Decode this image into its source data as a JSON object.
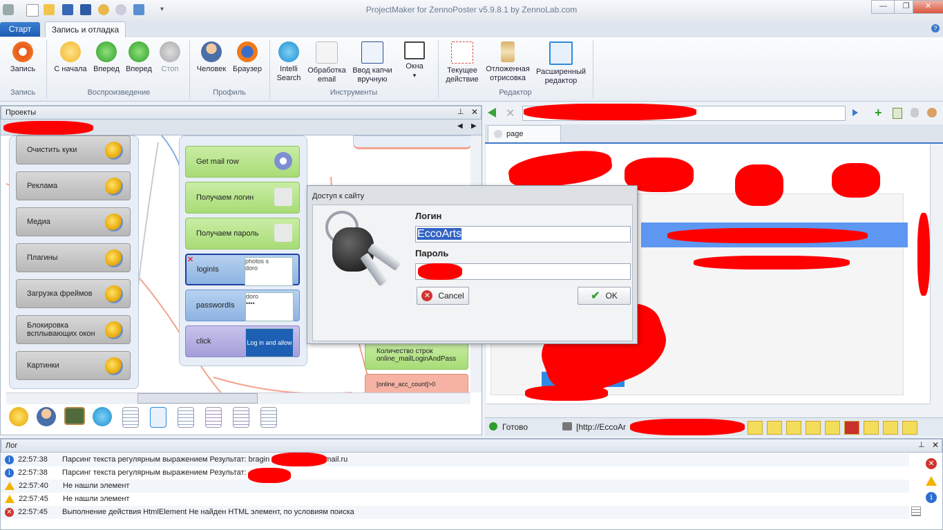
{
  "window": {
    "title": "ProjectMaker for ZennoPoster v5.9.8.1 by ZennoLab.com"
  },
  "tabs": [
    {
      "label": "Старт"
    },
    {
      "label": "Запись и отладка"
    }
  ],
  "ribbon": {
    "groups": [
      {
        "label": "Запись",
        "buttons": [
          {
            "label": "Запись"
          }
        ]
      },
      {
        "label": "Воспроизведение",
        "buttons": [
          {
            "label": "С начала"
          },
          {
            "label": "Вперед"
          },
          {
            "label": "Вперед"
          },
          {
            "label": "Стоп"
          }
        ]
      },
      {
        "label": "Профиль",
        "buttons": [
          {
            "label": "Человек"
          },
          {
            "label": "Браузер"
          }
        ]
      },
      {
        "label": "Инструменты",
        "buttons": [
          {
            "label": "Intelli Search"
          },
          {
            "label": "Обработка email"
          },
          {
            "label": "Ввод капчи вручную"
          },
          {
            "label": "Окна"
          }
        ]
      },
      {
        "label": "Редактор",
        "buttons": [
          {
            "label": "Текущее действие"
          },
          {
            "label": "Отложенная отрисовка"
          },
          {
            "label": "Расширенный редактор"
          }
        ]
      }
    ]
  },
  "projects": {
    "title": "Проекты",
    "blocks": [
      "Очистить куки",
      "Реклама",
      "Медиа",
      "Плагины",
      "Загрузка фреймов",
      "Блокировка всплывающих окон",
      "Картинки"
    ],
    "actions": [
      {
        "label": "Get mail row"
      },
      {
        "label": "Получаем логин"
      },
      {
        "label": "Получаем пароль"
      },
      {
        "label": "loginIs",
        "thumb": "photos s\ndoro"
      },
      {
        "label": "passwordIs",
        "thumb": "doro\n••••"
      },
      {
        "label": "click",
        "thumb": "Log in and allow"
      }
    ],
    "lower_action": "Количество строк online_mailLoginAndPass",
    "lower_action2": "[online_acc_count]>0"
  },
  "dialog": {
    "title": "Доступ к сайту",
    "login_label": "Логин",
    "login_value": "EccoArts",
    "password_label": "Пароль",
    "cancel": "Cancel",
    "ok": "OK"
  },
  "browser": {
    "tab": "page",
    "status": "Готово",
    "url_prefix": "[http://EccoAr"
  },
  "log": {
    "title": "Лог",
    "rows": [
      {
        "level": "info",
        "time": "22:57:38",
        "text": "Парсинг текста регулярным выражением  Результат: bragin",
        "suffix": "mail.ru"
      },
      {
        "level": "info",
        "time": "22:57:38",
        "text": "Парсинг текста регулярным выражением  Результат:",
        "suffix": ""
      },
      {
        "level": "warn",
        "time": "22:57:40",
        "text": "Не нашли элемент",
        "suffix": ""
      },
      {
        "level": "warn",
        "time": "22:57:45",
        "text": "Не нашли элемент",
        "suffix": ""
      },
      {
        "level": "error",
        "time": "22:57:45",
        "text": "Выполнение действия HtmlElement Не найден HTML элемент, по условиям поиска",
        "suffix": ""
      }
    ]
  },
  "colors": {
    "accent": "#1b5cb3",
    "redaction": "#ff0000",
    "green_action": "#a7dc76",
    "blue_action": "#8db3e2"
  }
}
